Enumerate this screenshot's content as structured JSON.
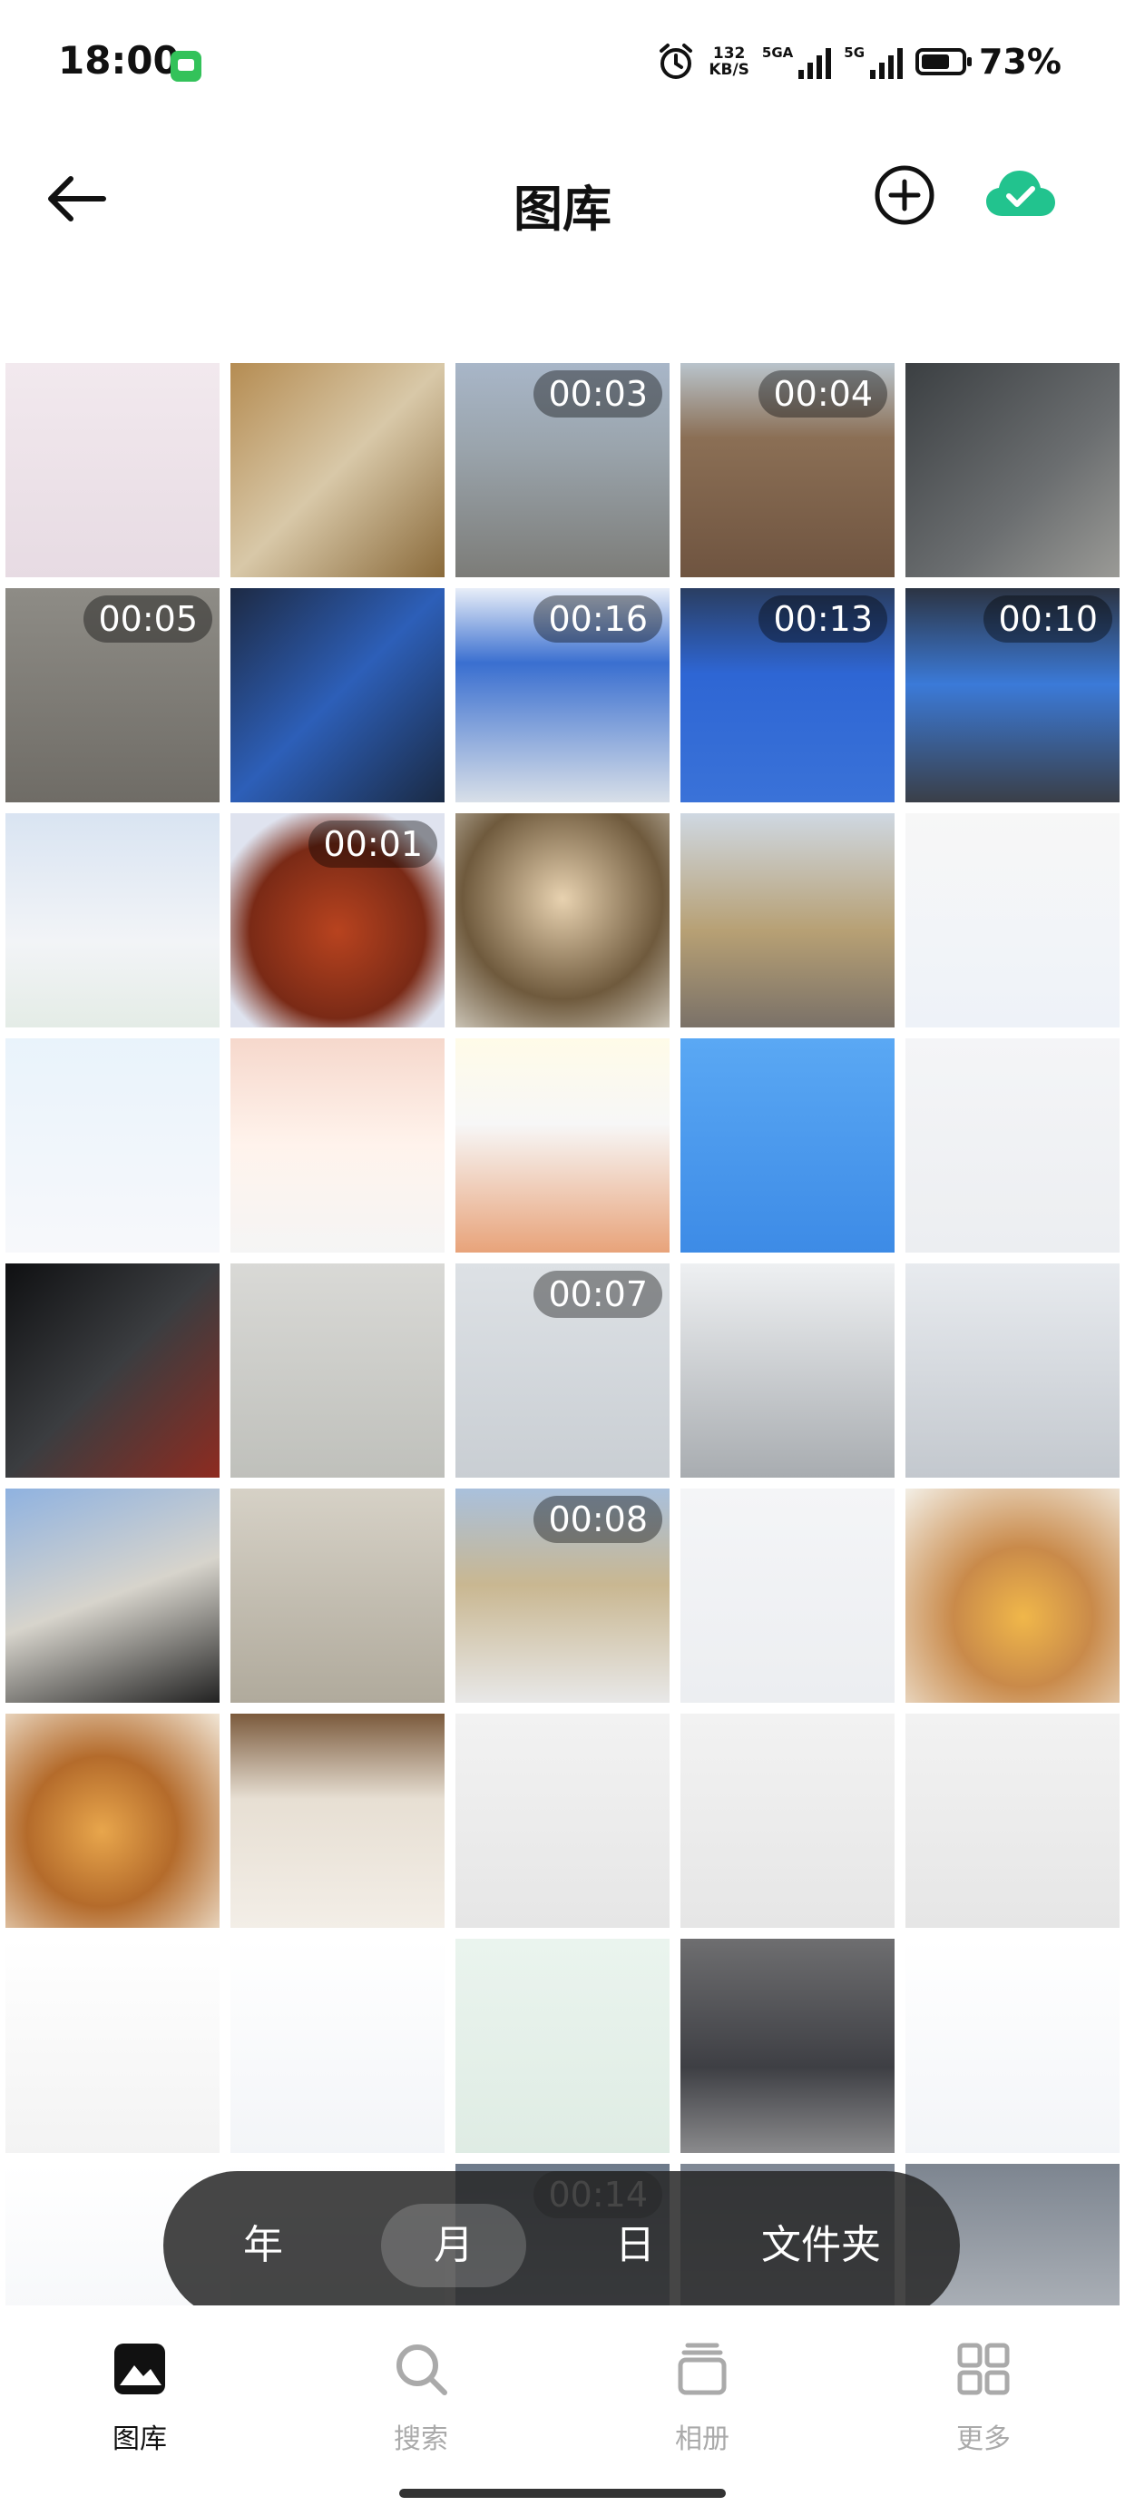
{
  "status_bar": {
    "time": "18:00",
    "net_rate_value": "132",
    "net_rate_unit": "KB/S",
    "net_label_1": "5GA",
    "net_label_2": "5G",
    "battery": "73%"
  },
  "header": {
    "title": "图库",
    "back_icon": "arrow-left-icon",
    "add_icon": "plus-circle-icon",
    "cloud_icon": "cloud-check-icon",
    "cloud_color": "#22c38e"
  },
  "grid": {
    "tiles": [
      {
        "bg": "linear-gradient(180deg,#f2e9ee,#e7dbe3)",
        "duration": ""
      },
      {
        "bg": "linear-gradient(135deg,#b58c52,#d8c8a8 50%,#8a6a3a)",
        "duration": ""
      },
      {
        "bg": "linear-gradient(180deg,#a8b6c8 0%,#9aa4ac 40%,#7c7c78 100%)",
        "duration": "00:03"
      },
      {
        "bg": "linear-gradient(180deg,#b9c4cc 0%,#8b6f55 35%,#6f5440 100%)",
        "duration": "00:04"
      },
      {
        "bg": "linear-gradient(135deg,#3b3f42,#6b6e70 60%,#9a9a96)",
        "duration": ""
      },
      {
        "bg": "linear-gradient(180deg,#8e8c86,#6f6c66)",
        "duration": "00:05"
      },
      {
        "bg": "linear-gradient(135deg,#1d2a44,#2d5fb8 50%,#1a2a44)",
        "duration": ""
      },
      {
        "bg": "linear-gradient(180deg,#e8eef8 0%,#3a6fd0 35%,#d8dfe8 100%)",
        "duration": "00:16"
      },
      {
        "bg": "linear-gradient(180deg,#2a3e62 0%,#2e66d4 40%,#3a72d8 100%)",
        "duration": "00:13"
      },
      {
        "bg": "linear-gradient(180deg,#2c3443 0%,#3b7ad8 45%,#3a3f48 100%)",
        "duration": "00:10"
      },
      {
        "bg": "linear-gradient(180deg,#d9e4f2,#f2f4f7 60%,#e4ece6)",
        "duration": ""
      },
      {
        "bg": "radial-gradient(circle at 50% 55%,#b8431f,#7a2a16 55%,#dfe3ef 80%)",
        "duration": "00:01"
      },
      {
        "bg": "radial-gradient(circle at 50% 40%,#e8d2b0,#6f5a3d 60%,#c9c2b4)",
        "duration": ""
      },
      {
        "bg": "linear-gradient(180deg,#cfd8e2 0%,#b7a074 55%,#7a7168 100%)",
        "duration": ""
      },
      {
        "bg": "linear-gradient(180deg,#f7f7f7,#eef2f8)",
        "duration": ""
      },
      {
        "bg": "linear-gradient(180deg,#e9f3fb,#f7f8fb)",
        "duration": ""
      },
      {
        "bg": "linear-gradient(180deg,#f6d8cc,#fff3ec 50%,#f5f5f5)",
        "duration": ""
      },
      {
        "bg": "linear-gradient(180deg,#fffbe8,#f7f7f7 40%,#e8a37a)",
        "duration": ""
      },
      {
        "bg": "linear-gradient(180deg,#5aa8f4,#3d8be6)",
        "duration": ""
      },
      {
        "bg": "linear-gradient(180deg,#f4f5f7,#eceef1)",
        "duration": ""
      },
      {
        "bg": "linear-gradient(135deg,#0f1012,#3b3d40 50%,#8e2b20)",
        "duration": ""
      },
      {
        "bg": "linear-gradient(180deg,#d9d9d6,#bfc0bb)",
        "duration": ""
      },
      {
        "bg": "linear-gradient(180deg,#dde1e5,#c9ced3)",
        "duration": "00:07"
      },
      {
        "bg": "linear-gradient(180deg,#eef0f2,#a8acb0)",
        "duration": ""
      },
      {
        "bg": "linear-gradient(180deg,#e8ebef,#c3c8ce)",
        "duration": ""
      },
      {
        "bg": "linear-gradient(160deg,#8fb2e0,#d7d4cc 50%,#222)",
        "duration": ""
      },
      {
        "bg": "linear-gradient(180deg,#d6d1c6,#b0aa9c)",
        "duration": ""
      },
      {
        "bg": "linear-gradient(180deg,#a9c0dc 0%,#c9b791 45%,#e8e8e8 100%)",
        "duration": "00:08"
      },
      {
        "bg": "linear-gradient(180deg,#f4f5f7,#eceef1)",
        "duration": ""
      },
      {
        "bg": "radial-gradient(circle at 55% 60%,#f0b74a,#c98a4a 40%,#f3efe6)",
        "duration": ""
      },
      {
        "bg": "radial-gradient(circle at 45% 55%,#e8a64c,#b46b2b 45%,#f1e6d6)",
        "duration": ""
      },
      {
        "bg": "linear-gradient(180deg,#7b5a3c,#e7dfd3 40%,#f3eee7)",
        "duration": ""
      },
      {
        "bg": "linear-gradient(180deg,#f2f2f2,#e6e6e6)",
        "duration": ""
      },
      {
        "bg": "linear-gradient(180deg,#f2f2f2,#e6e6e6)",
        "duration": ""
      },
      {
        "bg": "linear-gradient(180deg,#f2f2f2,#e6e6e6)",
        "duration": ""
      },
      {
        "bg": "linear-gradient(180deg,#ffffff,#f3f3f3)",
        "duration": ""
      },
      {
        "bg": "linear-gradient(180deg,#ffffff,#f3f5f8)",
        "duration": ""
      },
      {
        "bg": "linear-gradient(180deg,#eaf4ee,#dfece4)",
        "duration": ""
      },
      {
        "bg": "linear-gradient(180deg,#6e6e70,#3e3f44 60%,#8a8a8c)",
        "duration": ""
      },
      {
        "bg": "linear-gradient(180deg,#ffffff,#f3f5f8)",
        "duration": ""
      },
      {
        "bg": "linear-gradient(180deg,#ffffff,#f3f5f8)",
        "duration": ""
      },
      {
        "bg": "linear-gradient(180deg,#ffffff,#e9eef4)",
        "duration": ""
      },
      {
        "bg": "linear-gradient(180deg,#6d7a8a,#a9b4c2)",
        "duration": "00:14"
      },
      {
        "bg": "linear-gradient(180deg,#7e8794,#b3b8bf)",
        "duration": ""
      },
      {
        "bg": "linear-gradient(180deg,#7d8590,#bfc3c8)",
        "duration": ""
      }
    ]
  },
  "segments": {
    "items": [
      {
        "label": "年"
      },
      {
        "label": "月"
      },
      {
        "label": "日"
      },
      {
        "label": "文件夹"
      }
    ],
    "active_index": 1
  },
  "bottom_nav": {
    "items": [
      {
        "label": "图库",
        "icon": "photo-icon",
        "active": true
      },
      {
        "label": "搜索",
        "icon": "search-icon",
        "active": false
      },
      {
        "label": "相册",
        "icon": "album-icon",
        "active": false
      },
      {
        "label": "更多",
        "icon": "grid-icon",
        "active": false
      }
    ]
  }
}
